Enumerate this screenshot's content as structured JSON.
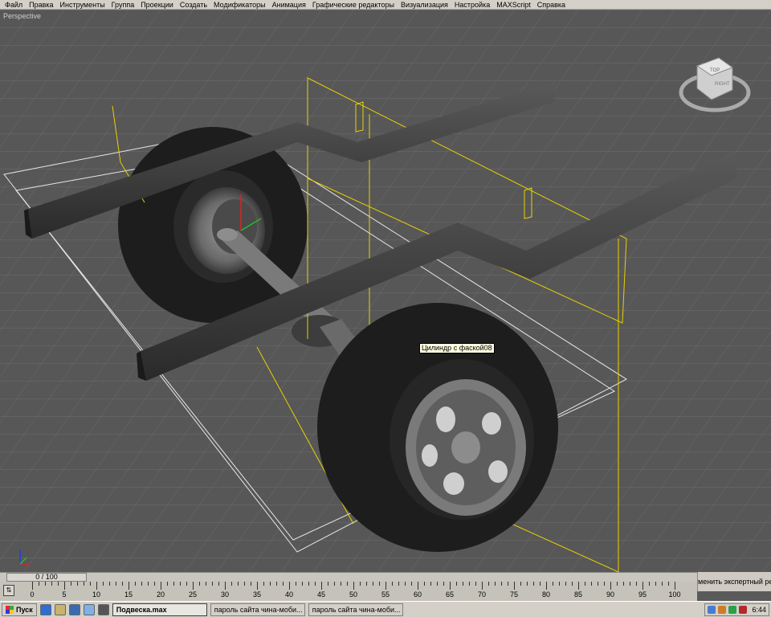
{
  "menu": [
    "Файл",
    "Правка",
    "Инструменты",
    "Группа",
    "Проекции",
    "Создать",
    "Модификаторы",
    "Анимация",
    "Графические редакторы",
    "Визуализация",
    "Настройка",
    "MAXScript",
    "Справка"
  ],
  "viewport": {
    "label": "Perspective",
    "tooltip": "Цилиндр с фаской08",
    "viewcube_top": "TOP",
    "viewcube_right": "RIGHT"
  },
  "timeline": {
    "slider": "0 / 100",
    "ticks": [
      "0",
      "5",
      "10",
      "15",
      "20",
      "25",
      "30",
      "35",
      "40",
      "45",
      "50",
      "55",
      "60",
      "65",
      "70",
      "75",
      "80",
      "85",
      "90",
      "95",
      "100"
    ],
    "hint": "менить экспертный реж"
  },
  "taskbar": {
    "start": "Пуск",
    "tasks": [
      "Подвеска.max",
      "пароль сайта чина-моби...",
      "пароль сайта чина-моби..."
    ],
    "clock": "6:44"
  },
  "colors": {
    "selection": "#e8d000",
    "grid": "#6d6d6d",
    "tire": "#1e1e1e",
    "frame": "#3a3a3a"
  }
}
